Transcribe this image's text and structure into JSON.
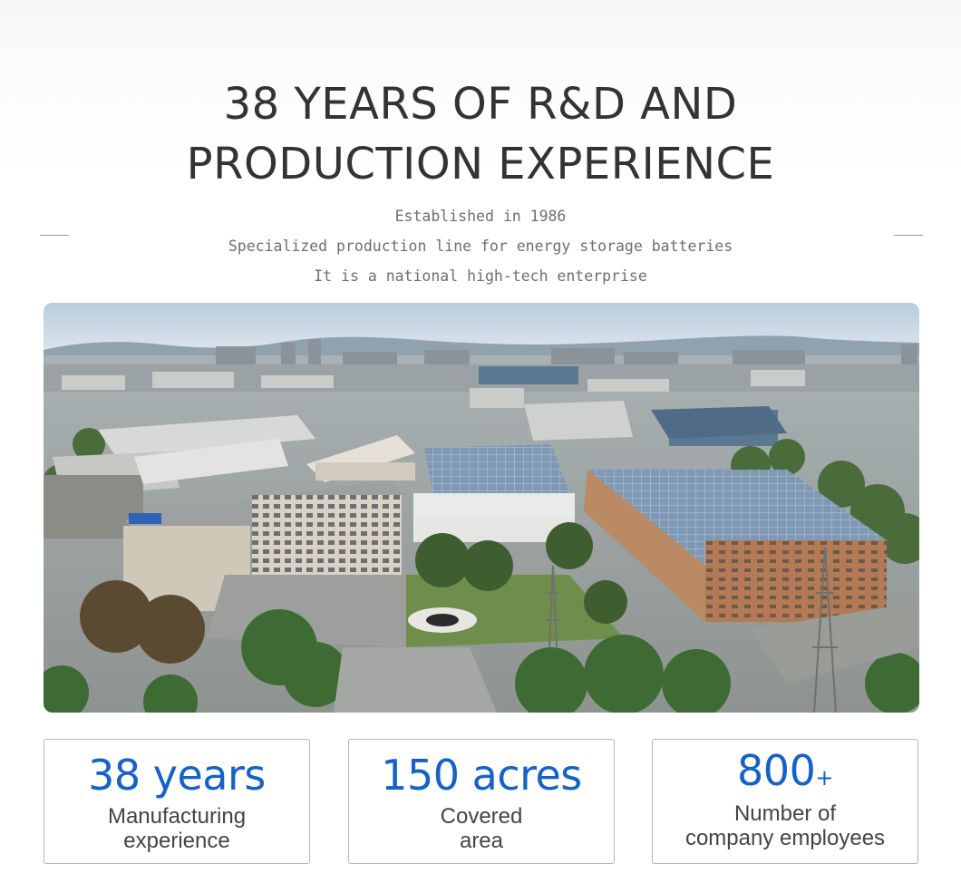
{
  "heading": {
    "line1": "38 YEARS OF R&D AND",
    "line2": "PRODUCTION EXPERIENCE"
  },
  "subheading": {
    "line1": "Established in 1986",
    "line2": "Specialized production line for energy storage batteries",
    "line3": "It is a national high-tech enterprise"
  },
  "photo": {
    "subject": "aerial-factory-campus"
  },
  "stats": [
    {
      "value": "38 years",
      "suffix": "",
      "label_line1": "Manufacturing",
      "label_line2": "experience"
    },
    {
      "value": "150 acres",
      "suffix": "",
      "label_line1": "Covered",
      "label_line2": "area"
    },
    {
      "value": "800",
      "suffix": "+",
      "label_line1": "Number of",
      "label_line2": "company employees"
    }
  ],
  "colors": {
    "accent": "#1462c8",
    "heading": "#333333",
    "subtext": "#6e6e6e",
    "border": "#b5b5b5"
  }
}
